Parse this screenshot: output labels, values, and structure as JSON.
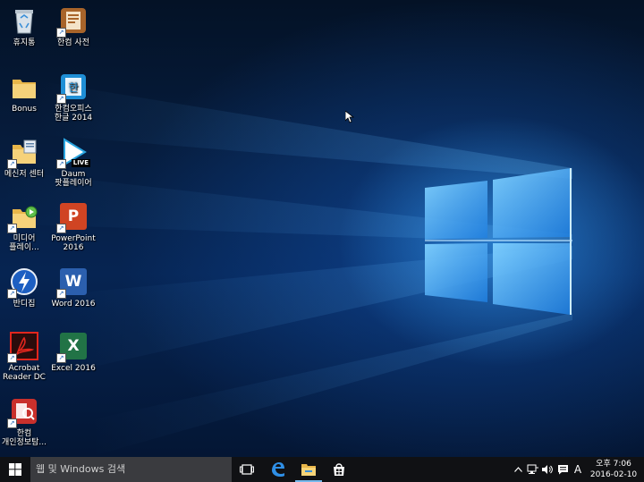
{
  "desktop_icons": [
    {
      "label": "휴지통"
    },
    {
      "label": "한컴 사전"
    },
    {
      "label": "Bonus"
    },
    {
      "label": "한컴오피스\n한글 2014"
    },
    {
      "label": "메신저 센터"
    },
    {
      "label": "Daum\n팟플레이어"
    },
    {
      "label": "미디어\n플레이..."
    },
    {
      "label": "PowerPoint\n2016"
    },
    {
      "label": "반디집"
    },
    {
      "label": "Word 2016"
    },
    {
      "label": "Acrobat\nReader DC"
    },
    {
      "label": "Excel 2016"
    },
    {
      "label": "한컴\n개인정보탐..."
    }
  ],
  "icon_glyphs": {
    "potplayer_live": "LIVE",
    "powerpoint": "P",
    "word": "W",
    "excel": "X",
    "hancom_word": "한"
  },
  "taskbar": {
    "search_placeholder": "웹 및 Windows 검색",
    "pinned": [
      "task-view-icon",
      "edge-icon",
      "file-explorer-icon",
      "store-icon"
    ],
    "tray": {
      "ime": "A",
      "time": "오후 7:06",
      "date": "2016-02-10"
    }
  },
  "colors": {
    "taskbar": "#101114",
    "search_box": "#3a3b3f",
    "accent": "#76b9ed",
    "wallpaper_glow": "#3ca9ff"
  }
}
